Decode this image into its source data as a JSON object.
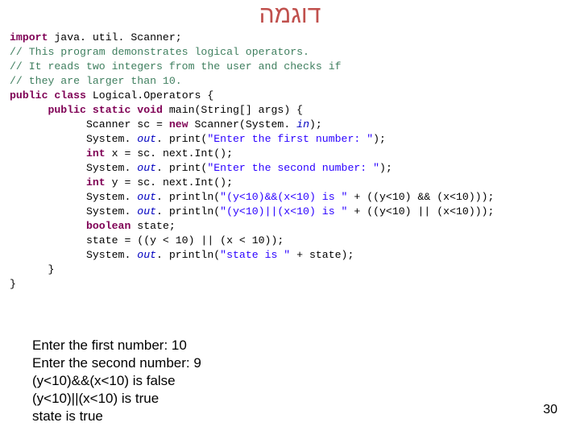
{
  "title": "דוגמה",
  "code": {
    "l1a": "import",
    "l1b": " java. util. Scanner;",
    "l2": "// This program demonstrates logical operators.",
    "l3": "// It reads two integers from the user and checks if",
    "l4": "// they are larger than 10.",
    "l5a": "public",
    "l5b": " ",
    "l5c": "class",
    "l5d": " Logical.Operators {",
    "l6a": "      ",
    "l6b": "public",
    "l6c": " ",
    "l6d": "static",
    "l6e": " ",
    "l6f": "void",
    "l6g": " main(String[] args) {",
    "l7a": "            Scanner sc = ",
    "l7b": "new",
    "l7c": " Scanner(System. ",
    "l7d": "in",
    "l7e": ");",
    "l8a": "            System. ",
    "l8b": "out",
    "l8c": ". print(",
    "l8d": "\"Enter the first number: \"",
    "l8e": ");",
    "l9a": "            ",
    "l9b": "int",
    "l9c": " x = sc. next.Int();",
    "l10a": "            System. ",
    "l10b": "out",
    "l10c": ". print(",
    "l10d": "\"Enter the second number: \"",
    "l10e": ");",
    "l11a": "            ",
    "l11b": "int",
    "l11c": " y = sc. next.Int();",
    "l12a": "            System. ",
    "l12b": "out",
    "l12c": ". println(",
    "l12d": "\"(y<10)&&(x<10) is \"",
    "l12e": " + ((y<10) && (x<10)));",
    "l13a": "            System. ",
    "l13b": "out",
    "l13c": ". println(",
    "l13d": "\"(y<10)||(x<10) is \"",
    "l13e": " + ((y<10) || (x<10)));",
    "l14a": "            ",
    "l14b": "boolean",
    "l14c": " state;",
    "l15": "            state = ((y < 10) || (x < 10));",
    "l16a": "            System. ",
    "l16b": "out",
    "l16c": ". println(",
    "l16d": "\"state is \"",
    "l16e": " + state);",
    "l17": "      }",
    "l18": "}"
  },
  "output": {
    "l1": "Enter the first number: 10",
    "l2": "Enter the second number: 9",
    "l3": " (y<10)&&(x<10) is false",
    "l4": " (y<10)||(x<10) is true",
    "l5": " state is true"
  },
  "page_number": "30"
}
